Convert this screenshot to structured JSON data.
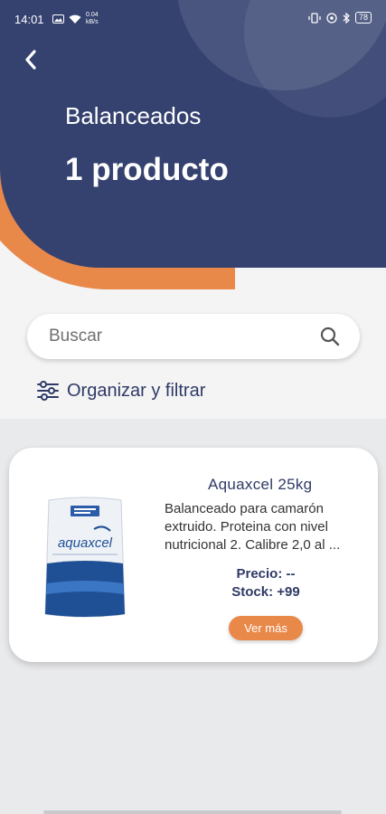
{
  "status_bar": {
    "time": "14:01",
    "net_speed_value": "0.04",
    "net_speed_unit": "kB/s",
    "battery": "78"
  },
  "header": {
    "back_icon": "chevron-left-icon",
    "category": "Balanceados",
    "count": "1 producto"
  },
  "search": {
    "placeholder": "Buscar",
    "value": "",
    "icon": "search-icon"
  },
  "filter": {
    "label": "Organizar y filtrar",
    "icon": "sliders-icon"
  },
  "products": [
    {
      "name": "Aquaxcel 25kg",
      "description": "Balanceado para camarón extruido. Proteina con nivel nutricional 2. Calibre 2,0 al ...",
      "price_label": "Precio: --",
      "stock_label": "Stock: +99",
      "button_label": "Ver más",
      "bag_brand": "aquaxcel"
    }
  ],
  "colors": {
    "navy": "#354270",
    "orange": "#e8894a",
    "text_navy": "#2f3a66"
  }
}
